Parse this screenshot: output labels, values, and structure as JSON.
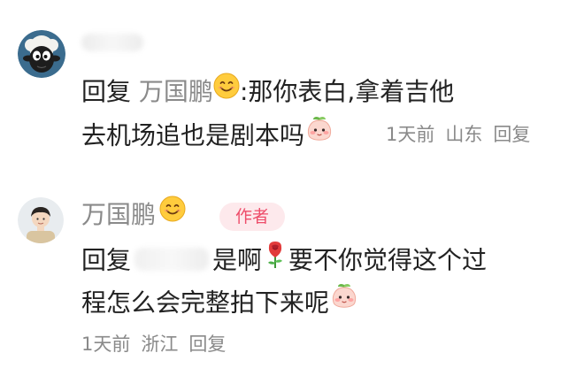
{
  "comment1": {
    "mention_prefix": "回复",
    "mention_name": "万国鹏",
    "text_part1": ":那你表白,拿着吉他",
    "text_part2": "去机场追也是剧本吗",
    "time": "1天前",
    "location": "山东",
    "reply_label": "回复"
  },
  "comment2": {
    "username": "万国鹏",
    "badge": "作者",
    "reply_prefix": "回复",
    "text_part1": "是啊",
    "text_part2": "要不你觉得这个过",
    "text_part3": "程怎么会完整拍下来呢",
    "time": "1天前",
    "location": "浙江",
    "reply_label": "回复"
  },
  "colors": {
    "text": "#222222",
    "muted": "#8a8a8a",
    "badge_bg": "#fde9ec",
    "badge_text": "#ee4d6a"
  },
  "icons": [
    "sheep-avatar",
    "user-photo-avatar",
    "smile-emoji-icon",
    "shy-peach-emoji-icon",
    "rose-emoji-icon"
  ]
}
